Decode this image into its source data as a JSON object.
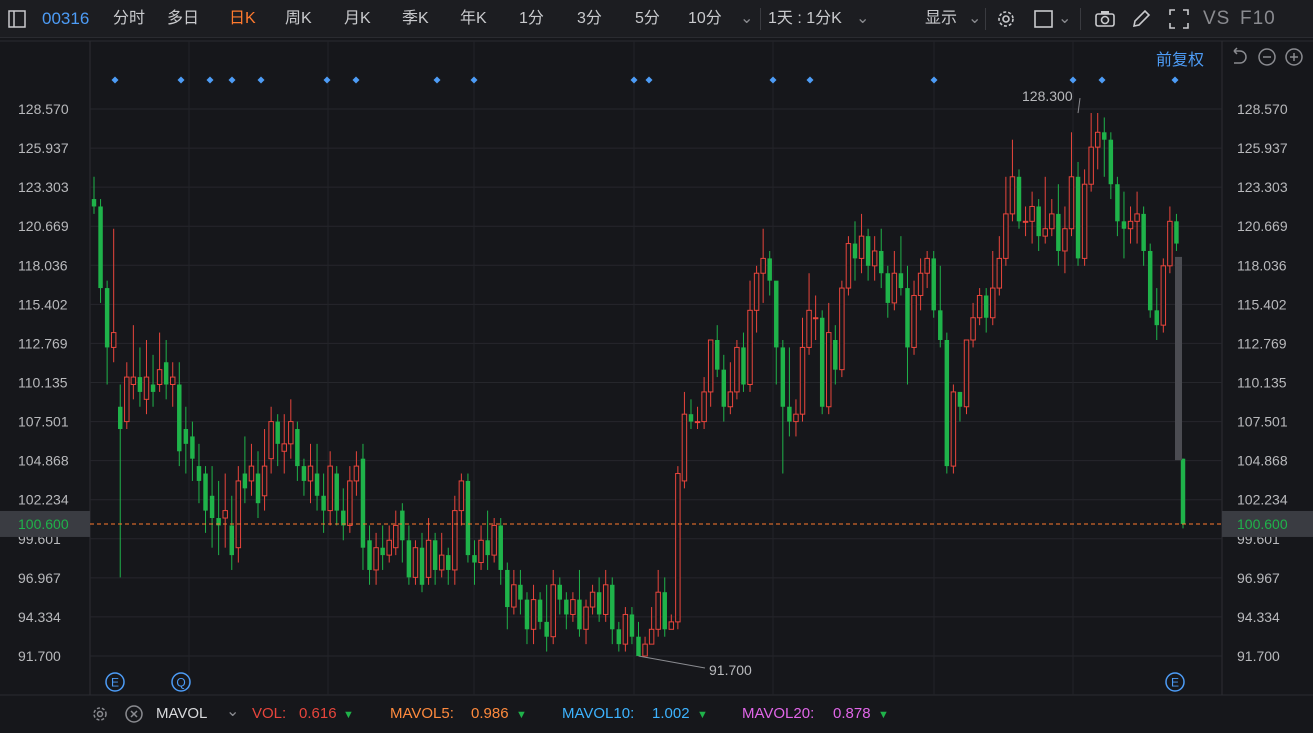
{
  "toolbar": {
    "code": "00316",
    "tabs": [
      "分时",
      "多日",
      "日K",
      "周K",
      "月K",
      "季K",
      "年K",
      "1分",
      "3分",
      "5分",
      "10分"
    ],
    "active_tab": "日K",
    "tab10_arrow": "⌄",
    "period_selector": "1天 : 1分K",
    "display_menu": "显示",
    "vs_label": "VS",
    "f10_label": "F10",
    "icons": [
      "settings-icon",
      "square-icon",
      "camera-icon",
      "pencil-icon",
      "fullscreen-icon"
    ]
  },
  "adjust_label": "前复权",
  "colors": {
    "up": "#e8453c",
    "down": "#1fb34a",
    "accent": "#4d9cf6",
    "orange": "#ff7a2e"
  },
  "price_axis": [
    "128.570",
    "125.937",
    "123.303",
    "120.669",
    "118.036",
    "115.402",
    "112.769",
    "110.135",
    "107.501",
    "104.868",
    "102.234",
    "99.601",
    "96.967",
    "94.334",
    "91.700"
  ],
  "current_price": "100.600",
  "annotations": {
    "high": "128.300",
    "low": "91.700"
  },
  "event_markers": {
    "bottom": [
      "E",
      "Q",
      "E"
    ]
  },
  "volume_bar": {
    "indicator": "MAVOL",
    "vol_label": "VOL:",
    "vol_value": "0.616",
    "mavol5_label": "MAVOL5:",
    "mavol5_value": "0.986",
    "mavol10_label": "MAVOL10:",
    "mavol10_value": "1.002",
    "mavol20_label": "MAVOL20:",
    "mavol20_value": "0.878"
  },
  "chart_data": {
    "type": "candlestick",
    "ylim": [
      91.7,
      128.57
    ],
    "candles": [
      [
        122.5,
        122.0,
        124.0,
        121.5
      ],
      [
        122.0,
        116.5,
        122.5,
        115.5
      ],
      [
        116.5,
        112.5,
        117.0,
        110.0
      ],
      [
        112.5,
        113.5,
        120.5,
        111.5
      ],
      [
        108.5,
        107.0,
        110.0,
        97.0
      ],
      [
        107.5,
        110.5,
        111.5,
        107.0
      ],
      [
        110.0,
        110.5,
        114.0,
        109.0
      ],
      [
        110.5,
        109.5,
        112.5,
        108.5
      ],
      [
        109.0,
        110.5,
        113.0,
        108.0
      ],
      [
        110.0,
        109.5,
        112.0,
        108.5
      ],
      [
        110.0,
        111.0,
        113.5,
        109.5
      ],
      [
        111.5,
        110.0,
        113.0,
        109.0
      ],
      [
        110.0,
        110.5,
        111.5,
        108.5
      ],
      [
        110.0,
        105.5,
        111.5,
        104.5
      ],
      [
        107.0,
        106.0,
        108.5,
        104.0
      ],
      [
        106.5,
        105.0,
        107.5,
        103.5
      ],
      [
        104.5,
        103.5,
        106.0,
        102.0
      ],
      [
        104.0,
        101.5,
        104.5,
        100.0
      ],
      [
        102.5,
        101.0,
        104.5,
        99.0
      ],
      [
        101.0,
        100.5,
        103.5,
        98.5
      ],
      [
        101.0,
        101.5,
        104.0,
        99.0
      ],
      [
        100.5,
        98.5,
        102.5,
        97.5
      ],
      [
        99.0,
        103.5,
        104.5,
        98.0
      ],
      [
        104.0,
        103.0,
        106.5,
        102.0
      ],
      [
        103.5,
        104.5,
        106.0,
        102.5
      ],
      [
        104.0,
        102.0,
        105.5,
        101.0
      ],
      [
        102.5,
        104.5,
        107.0,
        101.5
      ],
      [
        105.0,
        107.5,
        108.5,
        104.0
      ],
      [
        107.5,
        106.0,
        108.0,
        104.5
      ],
      [
        105.5,
        106.0,
        108.0,
        104.0
      ],
      [
        106.0,
        107.5,
        109.0,
        105.0
      ],
      [
        107.0,
        104.5,
        107.5,
        103.5
      ],
      [
        104.5,
        103.5,
        105.0,
        102.5
      ],
      [
        103.5,
        104.5,
        106.0,
        102.0
      ],
      [
        104.0,
        102.5,
        106.0,
        101.5
      ],
      [
        102.5,
        101.5,
        104.0,
        100.0
      ],
      [
        101.5,
        104.5,
        105.5,
        100.5
      ],
      [
        104.0,
        101.5,
        104.5,
        100.5
      ],
      [
        101.5,
        100.5,
        103.0,
        99.5
      ],
      [
        100.5,
        103.5,
        104.5,
        100.0
      ],
      [
        103.5,
        104.5,
        105.5,
        102.5
      ],
      [
        105.0,
        99.0,
        106.0,
        97.5
      ],
      [
        99.5,
        97.5,
        100.5,
        96.5
      ],
      [
        97.5,
        99.0,
        100.0,
        96.5
      ],
      [
        99.0,
        98.5,
        100.5,
        97.5
      ],
      [
        98.5,
        99.5,
        100.5,
        98.0
      ],
      [
        99.0,
        100.5,
        101.5,
        98.5
      ],
      [
        101.5,
        99.5,
        102.0,
        98.0
      ],
      [
        99.5,
        97.0,
        100.5,
        96.5
      ],
      [
        97.0,
        99.0,
        99.5,
        96.5
      ],
      [
        99.0,
        96.5,
        100.0,
        96.0
      ],
      [
        97.0,
        99.5,
        101.0,
        96.5
      ],
      [
        99.5,
        97.5,
        100.0,
        96.5
      ],
      [
        97.5,
        98.5,
        100.0,
        97.0
      ],
      [
        98.5,
        97.5,
        99.0,
        96.5
      ],
      [
        97.5,
        101.5,
        102.5,
        96.5
      ],
      [
        101.5,
        103.5,
        104.0,
        100.5
      ],
      [
        103.5,
        98.5,
        104.0,
        98.0
      ],
      [
        98.5,
        98.0,
        99.5,
        96.5
      ],
      [
        98.0,
        99.5,
        100.5,
        97.5
      ],
      [
        99.5,
        98.5,
        101.5,
        97.5
      ],
      [
        98.5,
        100.5,
        101.0,
        98.0
      ],
      [
        100.5,
        97.5,
        101.0,
        96.5
      ],
      [
        97.5,
        95.0,
        98.0,
        93.5
      ],
      [
        95.0,
        96.5,
        97.5,
        94.5
      ],
      [
        96.5,
        95.5,
        97.5,
        94.5
      ],
      [
        95.5,
        93.5,
        96.0,
        92.5
      ],
      [
        93.5,
        95.5,
        96.5,
        92.5
      ],
      [
        95.5,
        94.0,
        96.0,
        93.5
      ],
      [
        94.0,
        93.0,
        96.5,
        92.0
      ],
      [
        93.0,
        96.5,
        97.5,
        92.5
      ],
      [
        96.5,
        95.5,
        97.0,
        94.5
      ],
      [
        95.5,
        94.5,
        96.0,
        93.5
      ],
      [
        94.5,
        95.5,
        96.0,
        94.0
      ],
      [
        95.5,
        93.5,
        97.5,
        93.0
      ],
      [
        93.5,
        95.0,
        95.5,
        92.5
      ],
      [
        95.0,
        96.0,
        96.5,
        94.5
      ],
      [
        96.0,
        94.5,
        97.0,
        94.0
      ],
      [
        94.5,
        96.5,
        97.5,
        94.0
      ],
      [
        96.5,
        93.5,
        97.0,
        92.5
      ],
      [
        93.5,
        92.5,
        94.0,
        92.0
      ],
      [
        92.5,
        94.5,
        95.0,
        92.0
      ],
      [
        94.5,
        93.0,
        95.0,
        92.5
      ],
      [
        93.0,
        91.7,
        94.0,
        91.7
      ],
      [
        91.7,
        92.5,
        93.0,
        91.7
      ],
      [
        92.5,
        93.5,
        95.0,
        92.5
      ],
      [
        93.5,
        96.0,
        97.5,
        93.0
      ],
      [
        96.0,
        93.5,
        97.0,
        93.0
      ],
      [
        93.5,
        94.0,
        94.5,
        93.5
      ],
      [
        94.0,
        104.0,
        104.5,
        93.5
      ],
      [
        103.5,
        108.0,
        109.5,
        103.0
      ],
      [
        108.0,
        107.5,
        109.0,
        107.0
      ],
      [
        107.5,
        107.5,
        108.5,
        107.0
      ],
      [
        107.5,
        109.5,
        110.5,
        107.0
      ],
      [
        109.5,
        113.0,
        113.0,
        108.5
      ],
      [
        113.0,
        111.0,
        114.0,
        110.5
      ],
      [
        111.0,
        108.5,
        112.0,
        107.5
      ],
      [
        108.5,
        109.5,
        111.5,
        108.0
      ],
      [
        109.5,
        112.5,
        113.0,
        109.0
      ],
      [
        112.5,
        110.0,
        113.5,
        109.5
      ],
      [
        110.0,
        115.0,
        117.0,
        109.5
      ],
      [
        115.0,
        117.5,
        118.0,
        113.5
      ],
      [
        117.5,
        118.5,
        120.5,
        115.5
      ],
      [
        118.5,
        117.0,
        119.0,
        116.0
      ],
      [
        117.0,
        112.5,
        113.5,
        110.0
      ],
      [
        112.5,
        108.5,
        113.0,
        104.0
      ],
      [
        108.5,
        107.5,
        112.5,
        106.5
      ],
      [
        107.5,
        108.0,
        109.0,
        106.5
      ],
      [
        108.0,
        112.5,
        114.5,
        107.5
      ],
      [
        112.5,
        115.0,
        117.5,
        112.0
      ],
      [
        114.5,
        114.5,
        116.0,
        113.0
      ],
      [
        114.5,
        108.5,
        115.0,
        108.0
      ],
      [
        108.5,
        113.5,
        115.5,
        108.0
      ],
      [
        113.0,
        111.0,
        114.0,
        110.0
      ],
      [
        111.0,
        116.5,
        117.0,
        110.5
      ],
      [
        116.5,
        119.5,
        120.0,
        116.0
      ],
      [
        119.5,
        118.5,
        121.0,
        117.0
      ],
      [
        118.5,
        120.0,
        121.5,
        117.5
      ],
      [
        120.0,
        118.0,
        120.5,
        117.0
      ],
      [
        118.0,
        119.0,
        120.0,
        117.0
      ],
      [
        119.0,
        117.5,
        120.5,
        116.5
      ],
      [
        117.5,
        115.5,
        118.0,
        114.5
      ],
      [
        115.5,
        117.5,
        119.0,
        115.0
      ],
      [
        117.5,
        116.5,
        120.0,
        116.0
      ],
      [
        116.5,
        112.5,
        118.0,
        110.0
      ],
      [
        112.5,
        116.0,
        117.0,
        112.0
      ],
      [
        116.0,
        117.5,
        118.5,
        115.0
      ],
      [
        117.5,
        118.5,
        119.0,
        116.5
      ],
      [
        118.5,
        115.0,
        119.0,
        114.5
      ],
      [
        115.0,
        113.0,
        118.0,
        112.5
      ],
      [
        113.0,
        104.5,
        113.5,
        104.0
      ],
      [
        104.5,
        109.5,
        110.0,
        104.0
      ],
      [
        109.5,
        108.5,
        109.5,
        107.5
      ],
      [
        108.5,
        113.0,
        113.0,
        108.0
      ],
      [
        113.0,
        114.5,
        115.5,
        112.5
      ],
      [
        114.5,
        116.0,
        116.5,
        114.0
      ],
      [
        116.0,
        114.5,
        116.5,
        113.5
      ],
      [
        114.5,
        116.5,
        119.0,
        114.0
      ],
      [
        116.5,
        118.5,
        120.0,
        116.0
      ],
      [
        118.5,
        121.5,
        124.0,
        118.0
      ],
      [
        121.5,
        124.0,
        126.5,
        121.0
      ],
      [
        124.0,
        121.0,
        124.5,
        120.5
      ],
      [
        121.0,
        121.0,
        122.0,
        120.0
      ],
      [
        121.0,
        122.0,
        123.0,
        119.5
      ],
      [
        122.0,
        120.0,
        122.5,
        119.0
      ],
      [
        120.0,
        120.5,
        124.0,
        119.5
      ],
      [
        120.5,
        121.5,
        122.5,
        120.0
      ],
      [
        121.5,
        119.0,
        123.5,
        118.0
      ],
      [
        119.0,
        120.5,
        122.0,
        117.5
      ],
      [
        120.5,
        124.0,
        127.0,
        120.0
      ],
      [
        124.0,
        118.5,
        125.0,
        118.0
      ],
      [
        118.5,
        123.5,
        124.5,
        118.0
      ],
      [
        123.5,
        126.0,
        128.3,
        123.0
      ],
      [
        126.0,
        127.0,
        128.3,
        124.5
      ],
      [
        127.0,
        126.5,
        128.0,
        124.0
      ],
      [
        126.5,
        123.5,
        127.0,
        122.5
      ],
      [
        123.5,
        121.0,
        124.0,
        120.0
      ],
      [
        121.0,
        120.5,
        123.0,
        118.5
      ],
      [
        120.5,
        121.0,
        122.0,
        119.5
      ],
      [
        121.0,
        121.5,
        123.0,
        119.5
      ],
      [
        121.5,
        119.0,
        122.0,
        118.0
      ],
      [
        119.0,
        115.0,
        119.5,
        114.5
      ],
      [
        115.0,
        114.0,
        116.5,
        113.0
      ],
      [
        114.0,
        118.0,
        118.5,
        113.5
      ],
      [
        118.0,
        121.0,
        122.0,
        117.5
      ],
      [
        121.0,
        119.5,
        121.5,
        119.0
      ],
      [
        105.0,
        100.6,
        105.0,
        100.3
      ]
    ]
  }
}
